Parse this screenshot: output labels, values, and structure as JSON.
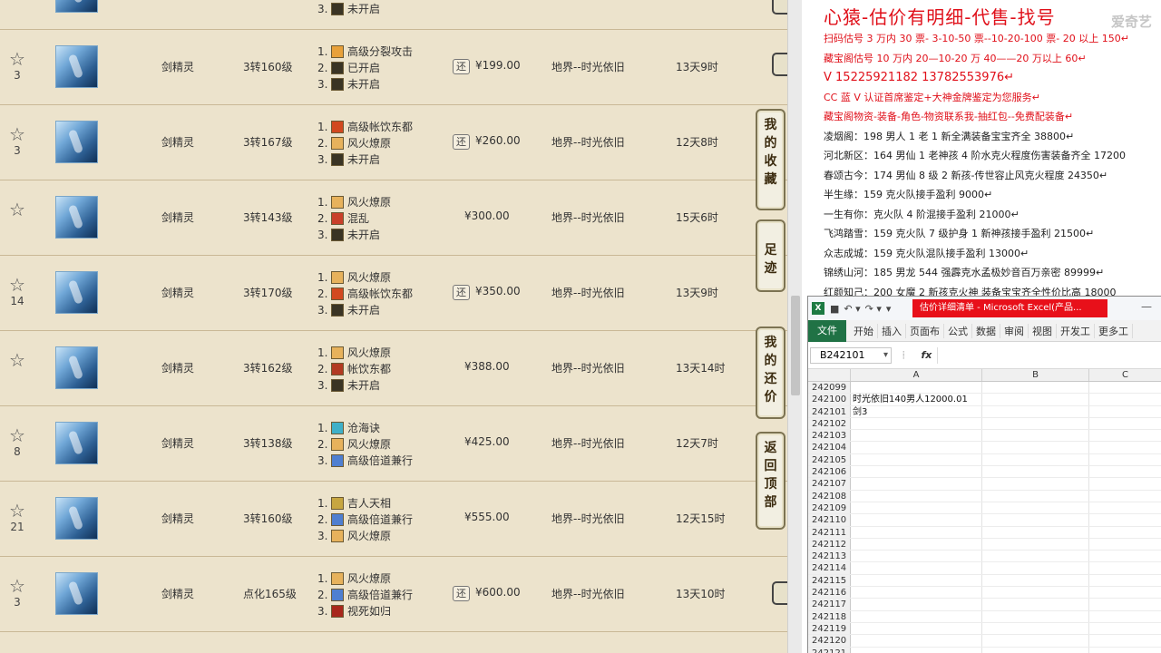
{
  "listings": [
    {
      "fav": "",
      "cls": "",
      "lvl": "",
      "skills": [
        {
          "n": "3.",
          "t": "未开启",
          "c": "#3a3424"
        }
      ],
      "badge": "",
      "price": "",
      "server": "",
      "time": ""
    },
    {
      "fav": "3",
      "cls": "剑精灵",
      "lvl": "3转160级",
      "skills": [
        {
          "n": "1.",
          "t": "高级分裂攻击",
          "c": "#e8a13a"
        },
        {
          "n": "2.",
          "t": "已开启",
          "c": "#3a3424"
        },
        {
          "n": "3.",
          "t": "未开启",
          "c": "#3a3424"
        }
      ],
      "badge": "还",
      "price": "¥199.00",
      "server": "地界--时光依旧",
      "time": "13天9时"
    },
    {
      "fav": "3",
      "cls": "剑精灵",
      "lvl": "3转167级",
      "skills": [
        {
          "n": "1.",
          "t": "高级帐饮东都",
          "c": "#d2491f"
        },
        {
          "n": "2.",
          "t": "风火燎原",
          "c": "#e7b25c"
        },
        {
          "n": "3.",
          "t": "未开启",
          "c": "#3a3424"
        }
      ],
      "badge": "还",
      "price": "¥260.00",
      "server": "地界--时光依旧",
      "time": "12天8时"
    },
    {
      "fav": "",
      "cls": "剑精灵",
      "lvl": "3转143级",
      "skills": [
        {
          "n": "1.",
          "t": "风火燎原",
          "c": "#e7b25c"
        },
        {
          "n": "2.",
          "t": "混乱",
          "c": "#c9402a"
        },
        {
          "n": "3.",
          "t": "未开启",
          "c": "#3a3424"
        }
      ],
      "badge": "",
      "price": "¥300.00",
      "server": "地界--时光依旧",
      "time": "15天6时"
    },
    {
      "fav": "14",
      "cls": "剑精灵",
      "lvl": "3转170级",
      "skills": [
        {
          "n": "1.",
          "t": "风火燎原",
          "c": "#e7b25c"
        },
        {
          "n": "2.",
          "t": "高级帐饮东都",
          "c": "#d2491f"
        },
        {
          "n": "3.",
          "t": "未开启",
          "c": "#3a3424"
        }
      ],
      "badge": "还",
      "price": "¥350.00",
      "server": "地界--时光依旧",
      "time": "13天9时"
    },
    {
      "fav": "",
      "cls": "剑精灵",
      "lvl": "3转162级",
      "skills": [
        {
          "n": "1.",
          "t": "风火燎原",
          "c": "#e7b25c"
        },
        {
          "n": "2.",
          "t": "帐饮东都",
          "c": "#b23a22"
        },
        {
          "n": "3.",
          "t": "未开启",
          "c": "#3a3424"
        }
      ],
      "badge": "",
      "price": "¥388.00",
      "server": "地界--时光依旧",
      "time": "13天14时"
    },
    {
      "fav": "8",
      "cls": "剑精灵",
      "lvl": "3转138级",
      "skills": [
        {
          "n": "1.",
          "t": "沧海诀",
          "c": "#3fb0c8"
        },
        {
          "n": "2.",
          "t": "风火燎原",
          "c": "#e7b25c"
        },
        {
          "n": "3.",
          "t": "高级倍道兼行",
          "c": "#4f7fd0"
        }
      ],
      "badge": "",
      "price": "¥425.00",
      "server": "地界--时光依旧",
      "time": "12天7时"
    },
    {
      "fav": "21",
      "cls": "剑精灵",
      "lvl": "3转160级",
      "skills": [
        {
          "n": "1.",
          "t": "吉人天相",
          "c": "#c7a640"
        },
        {
          "n": "2.",
          "t": "高级倍道兼行",
          "c": "#4f7fd0"
        },
        {
          "n": "3.",
          "t": "风火燎原",
          "c": "#e7b25c"
        }
      ],
      "badge": "",
      "price": "¥555.00",
      "server": "地界--时光依旧",
      "time": "12天15时"
    },
    {
      "fav": "3",
      "cls": "剑精灵",
      "lvl": "点化165级",
      "skills": [
        {
          "n": "1.",
          "t": "风火燎原",
          "c": "#e7b25c"
        },
        {
          "n": "2.",
          "t": "高级倍道兼行",
          "c": "#4f7fd0"
        },
        {
          "n": "3.",
          "t": "视死如归",
          "c": "#a8281c"
        }
      ],
      "badge": "还",
      "price": "¥600.00",
      "server": "地界--时光依旧",
      "time": "13天10时"
    }
  ],
  "side": {
    "fav_btn": "我的收藏",
    "trace_btn": "足迹",
    "offer_btn": "我的还价",
    "top_btn": "返回顶部"
  },
  "doc": {
    "watermark": "爱奇艺",
    "headline": "心猿-估价有明细-代售-找号",
    "lines_red": [
      "扫码估号 3 万内 30 票- 3-10-50 票--10-20-100 票- 20 以上 150↵",
      "藏宝阁估号 10 万内 20—10-20 万 40——20 万以上 60↵",
      "V 15225921182   13782553976↵",
      "CC 蓝 V 认证首席鉴定+大神金牌鉴定为您服务↵",
      "藏宝阁物资-装备-角色-物资联系我-抽红包--免费配装备↵"
    ],
    "lines": [
      "凌烟阁：198 男人 1 老 1 新全满装备宝宝齐全 38800↵",
      "河北新区：164 男仙 1 老神孩 4 阶水克火程度伤害装备齐全 17200",
      "春颂古今：174 男仙 8 级 2 新孩-传世容止风克火程度 24350↵",
      "半生缘：159 克火队接手盈利 9000↵",
      "一生有你：克火队 4 阶混接手盈利 21000↵",
      "飞鸿踏雪：159 克火队 7 级护身 1 新神孩接手盈利 21500↵",
      "众志成城：159 克火队混队接手盈利 13000↵",
      "锦绣山河：185 男龙 544 强霹克水孟极妙音百万亲密 89999↵",
      "红颜知己：200 女魔 2 新孩克火神 装备宝宝齐全性价比高 18000"
    ]
  },
  "excel": {
    "icon": "X",
    "title": "估价详细清单 - Microsoft Excel(产品...",
    "minimize": "—",
    "qa": [
      "↶ ▾",
      "↷ ▾",
      "▾"
    ],
    "tabs": [
      "开始",
      "插入",
      "页面布",
      "公式",
      "数据",
      "审阅",
      "视图",
      "开发工",
      "更多工"
    ],
    "file_tab": "文件",
    "namebox": "B242101",
    "fx_cancel": "⦙",
    "fx_label": "fx",
    "columns": [
      "A",
      "B",
      "C"
    ],
    "rows": [
      {
        "num": "242099",
        "a": ""
      },
      {
        "num": "242100",
        "a": "时光依旧140男人12000.01"
      },
      {
        "num": "242101",
        "a": "剑3"
      },
      {
        "num": "242102",
        "a": ""
      },
      {
        "num": "242103",
        "a": ""
      },
      {
        "num": "242104",
        "a": ""
      },
      {
        "num": "242105",
        "a": ""
      },
      {
        "num": "242106",
        "a": ""
      },
      {
        "num": "242107",
        "a": ""
      },
      {
        "num": "242108",
        "a": ""
      },
      {
        "num": "242109",
        "a": ""
      },
      {
        "num": "242110",
        "a": ""
      },
      {
        "num": "242111",
        "a": ""
      },
      {
        "num": "242112",
        "a": ""
      },
      {
        "num": "242113",
        "a": ""
      },
      {
        "num": "242114",
        "a": ""
      },
      {
        "num": "242115",
        "a": ""
      },
      {
        "num": "242116",
        "a": ""
      },
      {
        "num": "242117",
        "a": ""
      },
      {
        "num": "242118",
        "a": ""
      },
      {
        "num": "242119",
        "a": ""
      },
      {
        "num": "242120",
        "a": ""
      },
      {
        "num": "242121",
        "a": ""
      }
    ]
  }
}
